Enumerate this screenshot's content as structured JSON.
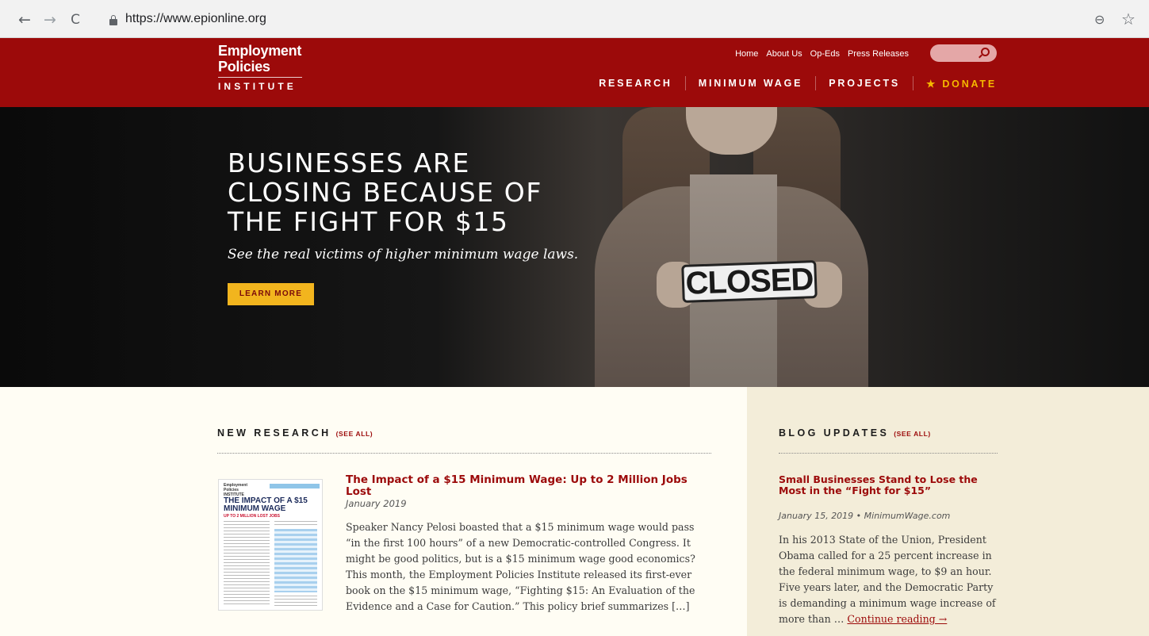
{
  "browser": {
    "url": "https://www.epionline.org",
    "back_icon": "←",
    "forward_icon": "→",
    "reload_icon": "C",
    "zoom_icon": "⊖",
    "bookmark_icon": "☆"
  },
  "header": {
    "logo_line1": "Employment",
    "logo_line2": "Policies",
    "logo_line3": "INSTITUTE",
    "utility_links": [
      "Home",
      "About Us",
      "Op-Eds",
      "Press Releases"
    ],
    "main_nav": [
      "RESEARCH",
      "MINIMUM WAGE",
      "PROJECTS"
    ],
    "donate_label": "★ DONATE",
    "brand_color": "#9c0a0a",
    "accent_color": "#f2b51e"
  },
  "hero": {
    "title": "BUSINESSES ARE CLOSING BECAUSE OF THE FIGHT FOR $15",
    "subtitle": "See the real victims of higher minimum wage laws.",
    "button_label": "LEARN MORE",
    "sign_text": "CLOSED"
  },
  "research": {
    "section_label": "NEW RESEARCH",
    "see_all": "(SEE ALL)",
    "thumbnail": {
      "org_line1": "Employment",
      "org_line2": "Policies",
      "org_line3": "INSTITUTE",
      "title": "THE IMPACT OF A $15 MINIMUM WAGE",
      "subtitle": "UP TO 2 MILLION LOST JOBS"
    },
    "article": {
      "title": "The Impact of a $15 Minimum Wage: Up to 2 Million Jobs Lost",
      "date": "January 2019",
      "excerpt": "Speaker Nancy Pelosi boasted that a $15 minimum wage would pass “in the first 100 hours” of a new Democratic-controlled Congress. It might be good politics, but is a $15 minimum wage good economics? This month, the Employment Policies Institute released its first-ever book on the $15 minimum wage, “Fighting $15: An Evaluation of the Evidence and a Case for Caution.” This policy brief summarizes […]"
    }
  },
  "blog": {
    "section_label": "BLOG UPDATES",
    "see_all": "(SEE ALL)",
    "post": {
      "title": "Small Businesses Stand to Lose the Most in the “Fight for $15”",
      "date": "January 15, 2019 • MinimumWage.com",
      "excerpt": "In his 2013 State of the Union, President Obama called for a 25 percent increase in the federal minimum wage, to $9 an hour. Five years later, and the Democratic Party is demanding a minimum wage increase of more than … ",
      "continue_label": "Continue reading →"
    }
  }
}
